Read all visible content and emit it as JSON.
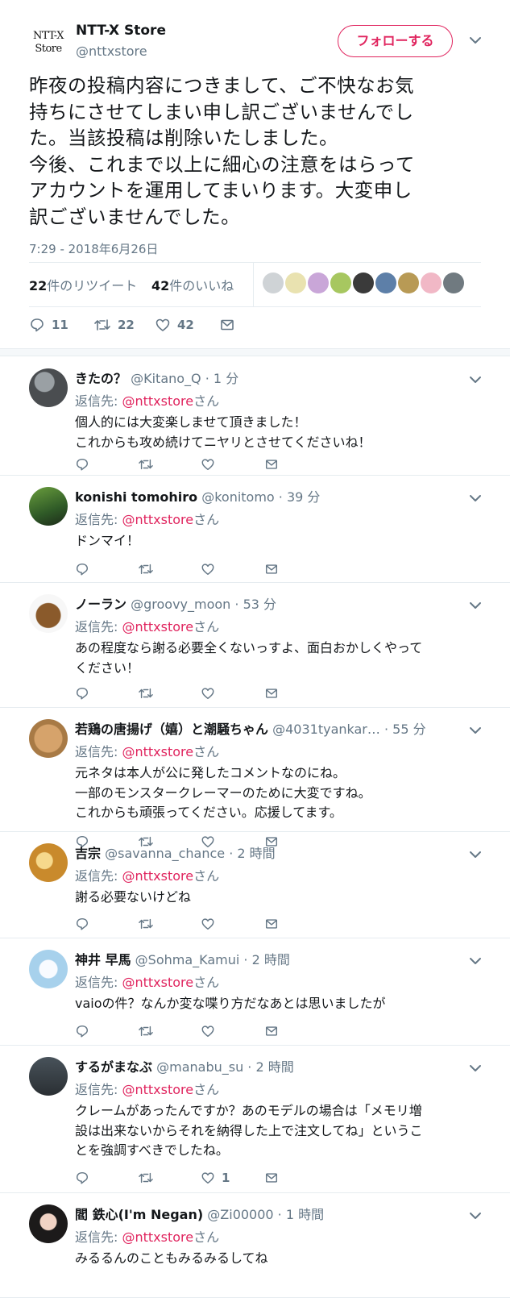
{
  "main_tweet": {
    "logo_lines": [
      "NTT-X",
      "Store"
    ],
    "name": "NTT-X Store",
    "handle": "@nttxstore",
    "follow_label": "フォローする",
    "text": "昨夜の投稿内容につきまして、ご不快なお気\n持ちにさせてしまい申し訳ございませんでし\nた。当該投稿は削除いたしました。\n今後、これまで以上に細心の注意をはらって\nアカウントを運用してまいります。大変申し\n訳ございませんでした。",
    "timestamp": "7:29 - 2018年6月26日",
    "retweet_count": "22",
    "retweet_label": "件のリツイート",
    "like_count": "42",
    "like_label": "件のいいね",
    "actions": {
      "reply": "11",
      "retweet": "22",
      "like": "42"
    }
  },
  "liker_avatar_colors": [
    "#cfd3d6",
    "#e9e2b0",
    "#c9a6d8",
    "#a7c760",
    "#3a3a3a",
    "#5d7fa8",
    "#b89a55",
    "#f1b8c6",
    "#707a80"
  ],
  "reply_prefix": "返信先: ",
  "reply_suffix": "さん",
  "reply_mention": "@nttxstore",
  "replies": [
    {
      "name": "きたの？",
      "handle": "@Kitano_Q",
      "time": "1 分",
      "text": "個人的には大変楽しませて頂きました！\nこれからも攻め続けてニヤリとさせてくださいね！",
      "like_count": ""
    },
    {
      "name": "konishi tomohiro",
      "handle": "@konitomo",
      "time": "39 分",
      "text": "ドンマイ！",
      "like_count": ""
    },
    {
      "name": "ノーラン",
      "handle": "@groovy_moon",
      "time": "53 分",
      "text": "あの程度なら謝る必要全くないっすよ、面白おかしくやって\nください！",
      "like_count": ""
    },
    {
      "name": "若鶏の唐揚げ（嬉）と潮騒ちゃん",
      "handle": "@4031tyankar…",
      "time": "55 分",
      "text": "元ネタは本人が公に発したコメントなのにね。\n一部のモンスタークレーマーのために大変ですね。\nこれからも頑張ってください。応援してます。",
      "like_count": ""
    },
    {
      "name": "吉宗",
      "handle": "@savanna_chance",
      "time": "2 時間",
      "text": "謝る必要ないけどね",
      "like_count": ""
    },
    {
      "name": "神井 早馬",
      "handle": "@Sohma_Kamui",
      "time": "2 時間",
      "text": "vaioの件？なんか変な喋り方だなあとは思いましたが",
      "like_count": ""
    },
    {
      "name": "するがまなぶ",
      "handle": "@manabu_su",
      "time": "2 時間",
      "text": "クレームがあったんですか？あのモデルの場合は「メモリ増\n設は出来ないからそれを納得した上で注文してね」というこ\nとを強調すべきでしたね。",
      "like_count": "1"
    },
    {
      "name": "閻 鉄心(I'm Negan)",
      "handle": "@Zi00000",
      "time": "1 時間",
      "text": "みるるんのこともみるみるしてね",
      "like_count": ""
    }
  ]
}
